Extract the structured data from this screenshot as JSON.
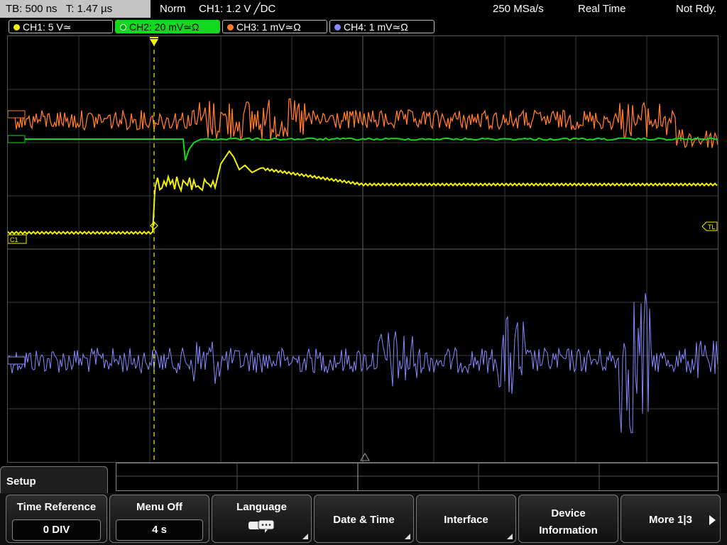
{
  "status_bar": {
    "timebase": "TB: 500 ns",
    "trigger_time": "T: 1.47 µs",
    "mode": "Norm",
    "trigger": "CH1: 1.2 V ╱DC",
    "sample_rate": "250 MSa/s",
    "acq_mode": "Real Time",
    "state": "Not Rdy."
  },
  "channels": [
    {
      "label": "CH1: 5 V≃",
      "color": "#f2f200"
    },
    {
      "label": "CH2: 20 mV≃Ω",
      "color": "#14d81e"
    },
    {
      "label": "CH3: 1 mV≃Ω",
      "color": "#ff7a2a"
    },
    {
      "label": "CH4: 1 mV≃Ω",
      "color": "#8888ff"
    }
  ],
  "markers": {
    "ch1": "C1",
    "trigger_level": "TL"
  },
  "menu": {
    "title": "Setup",
    "softkeys": [
      {
        "label": "Time Reference",
        "value": "0 DIV"
      },
      {
        "label": "Menu Off",
        "value": "4 s"
      },
      {
        "label": "Language",
        "icon": "speech-bubbles-icon"
      },
      {
        "label": "Date & Time"
      },
      {
        "label": "Interface"
      },
      {
        "label": "Device Information"
      },
      {
        "label": "More 1|3"
      }
    ]
  }
}
